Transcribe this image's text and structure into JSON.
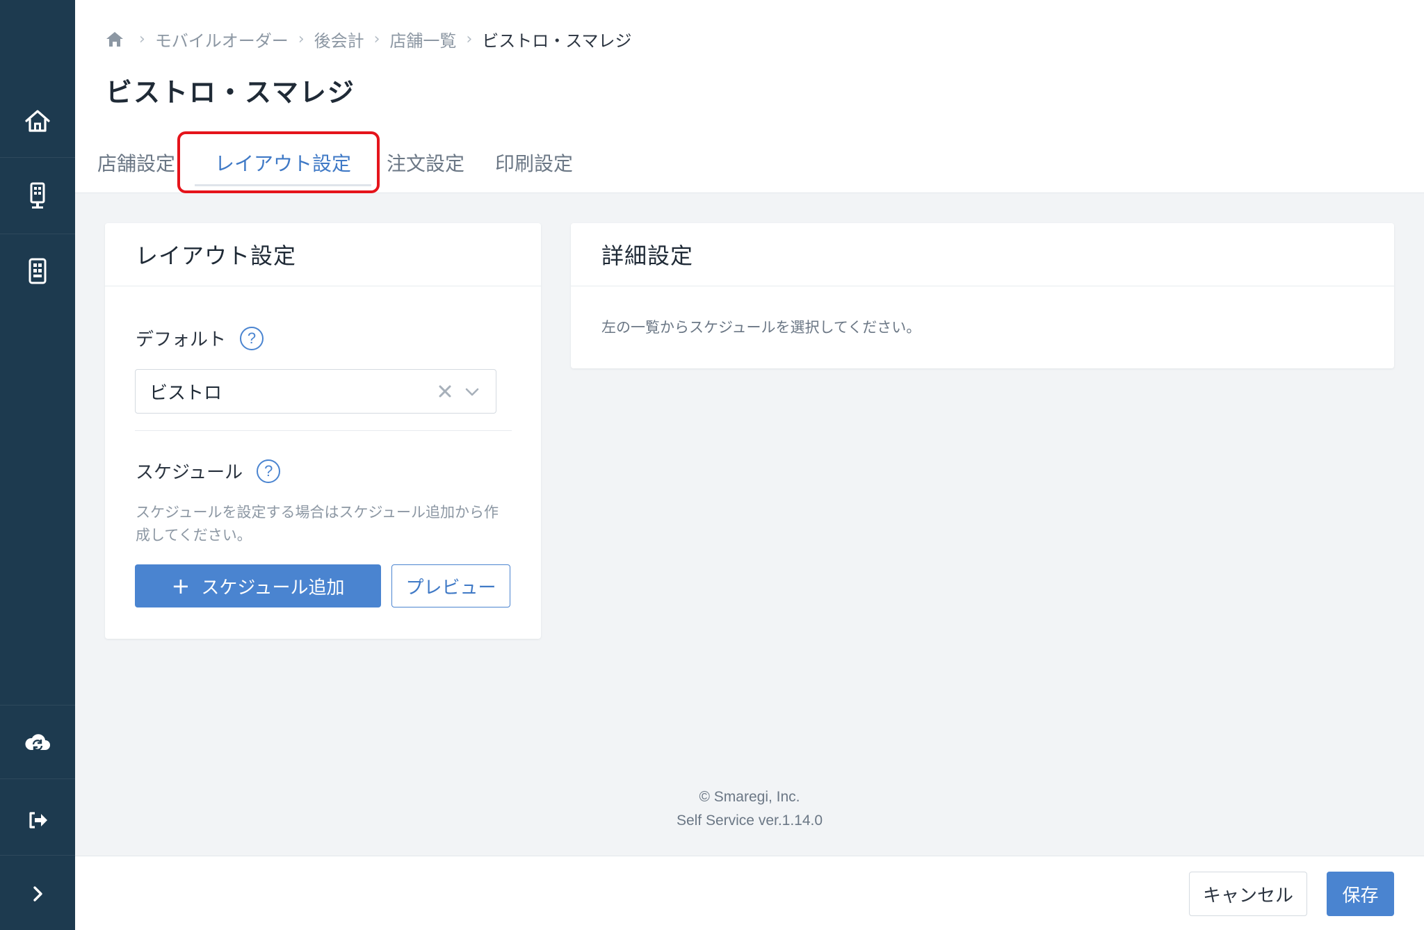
{
  "sidebar": {
    "items": [
      {
        "icon": "home-icon"
      },
      {
        "icon": "kiosk-terminal-icon"
      },
      {
        "icon": "mobile-order-icon"
      },
      {
        "icon": "cloud-sync-icon"
      },
      {
        "icon": "logout-icon"
      },
      {
        "icon": "expand-chevron-icon"
      }
    ],
    "background": "#1d3a4f"
  },
  "breadcrumb": {
    "home_icon": "home-icon",
    "items": [
      "モバイルオーダー",
      "後会計",
      "店舗一覧"
    ],
    "current": "ビストロ・スマレジ"
  },
  "page_title": "ビストロ・スマレジ",
  "tabs": [
    {
      "label": "店舗設定",
      "active": false
    },
    {
      "label": "レイアウト設定",
      "active": true
    },
    {
      "label": "注文設定",
      "active": false
    },
    {
      "label": "印刷設定",
      "active": false
    }
  ],
  "layout_card": {
    "title": "レイアウト設定",
    "default_label": "デフォルト",
    "default_help": "?",
    "default_value": "ビストロ",
    "schedule_label": "スケジュール",
    "schedule_help": "?",
    "schedule_hint": "スケジュールを設定する場合はスケジュール追加から作成してください。",
    "add_schedule_label": "スケジュール追加",
    "add_schedule_icon": "+",
    "preview_label": "プレビュー"
  },
  "detail_card": {
    "title": "詳細設定",
    "message": "左の一覧からスケジュールを選択してください。"
  },
  "footer": {
    "copyright": "© Smaregi, Inc.",
    "version": "Self Service ver.1.14.0"
  },
  "actions": {
    "cancel_label": "キャンセル",
    "save_label": "保存"
  },
  "colors": {
    "accent": "#4a84d0",
    "highlight": "#e5141b",
    "sidebar": "#1d3a4f"
  }
}
